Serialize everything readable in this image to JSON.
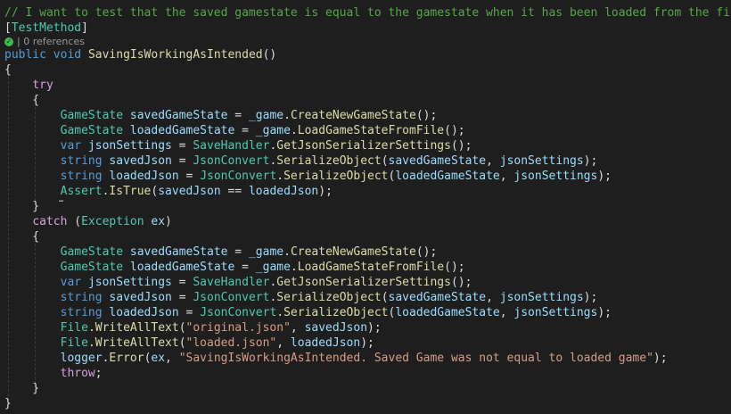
{
  "editor": {
    "codelens_references": "| 0 references",
    "lines": [
      [
        {
          "t": "// I want to test that the saved gamestate is equal to the gamestate when it has been loaded from the file",
          "c": "comment"
        }
      ],
      [
        {
          "t": "[",
          "c": "punct"
        },
        {
          "t": "TestMethod",
          "c": "attr"
        },
        {
          "t": "]",
          "c": "punct"
        }
      ],
      [
        {
          "t": "public",
          "c": "kw"
        },
        {
          "t": " ",
          "c": "punct"
        },
        {
          "t": "void",
          "c": "kw"
        },
        {
          "t": " ",
          "c": "punct"
        },
        {
          "t": "SavingIsWorkingAsIntended",
          "c": "method"
        },
        {
          "t": "()",
          "c": "punct"
        }
      ],
      [
        {
          "t": "{",
          "c": "punct"
        }
      ],
      [
        {
          "t": "    ",
          "c": "punct"
        },
        {
          "t": "try",
          "c": "ctl"
        }
      ],
      [
        {
          "t": "    {",
          "c": "punct"
        }
      ],
      [
        {
          "t": "        ",
          "c": "punct"
        },
        {
          "t": "GameState",
          "c": "type"
        },
        {
          "t": " ",
          "c": "punct"
        },
        {
          "t": "savedGameState",
          "c": "ident"
        },
        {
          "t": " = ",
          "c": "punct"
        },
        {
          "t": "_game",
          "c": "ident"
        },
        {
          "t": ".",
          "c": "punct"
        },
        {
          "t": "CreateNewGameState",
          "c": "method"
        },
        {
          "t": "();",
          "c": "punct"
        }
      ],
      [
        {
          "t": "        ",
          "c": "punct"
        },
        {
          "t": "GameState",
          "c": "type"
        },
        {
          "t": " ",
          "c": "punct"
        },
        {
          "t": "loadedGameState",
          "c": "ident"
        },
        {
          "t": " = ",
          "c": "punct"
        },
        {
          "t": "_game",
          "c": "ident"
        },
        {
          "t": ".",
          "c": "punct"
        },
        {
          "t": "LoadGameStateFromFile",
          "c": "method"
        },
        {
          "t": "();",
          "c": "punct"
        }
      ],
      [
        {
          "t": "        ",
          "c": "punct"
        },
        {
          "t": "var",
          "c": "kw"
        },
        {
          "t": " ",
          "c": "punct"
        },
        {
          "t": "jsonSettings",
          "c": "ident"
        },
        {
          "t": " = ",
          "c": "punct"
        },
        {
          "t": "SaveHandler",
          "c": "type"
        },
        {
          "t": ".",
          "c": "punct"
        },
        {
          "t": "GetJsonSerializerSettings",
          "c": "method"
        },
        {
          "t": "();",
          "c": "punct"
        }
      ],
      [
        {
          "t": "        ",
          "c": "punct"
        },
        {
          "t": "string",
          "c": "kw"
        },
        {
          "t": " ",
          "c": "punct"
        },
        {
          "t": "savedJson",
          "c": "ident"
        },
        {
          "t": " = ",
          "c": "punct"
        },
        {
          "t": "JsonConvert",
          "c": "type"
        },
        {
          "t": ".",
          "c": "punct"
        },
        {
          "t": "SerializeObject",
          "c": "method"
        },
        {
          "t": "(",
          "c": "punct"
        },
        {
          "t": "savedGameState",
          "c": "ident"
        },
        {
          "t": ", ",
          "c": "punct"
        },
        {
          "t": "jsonSettings",
          "c": "ident"
        },
        {
          "t": ");",
          "c": "punct"
        }
      ],
      [
        {
          "t": "        ",
          "c": "punct"
        },
        {
          "t": "string",
          "c": "kw"
        },
        {
          "t": " ",
          "c": "punct"
        },
        {
          "t": "loadedJson",
          "c": "ident"
        },
        {
          "t": " = ",
          "c": "punct"
        },
        {
          "t": "JsonConvert",
          "c": "type"
        },
        {
          "t": ".",
          "c": "punct"
        },
        {
          "t": "SerializeObject",
          "c": "method"
        },
        {
          "t": "(",
          "c": "punct"
        },
        {
          "t": "loadedGameState",
          "c": "ident"
        },
        {
          "t": ", ",
          "c": "punct"
        },
        {
          "t": "jsonSettings",
          "c": "ident"
        },
        {
          "t": ");",
          "c": "punct"
        }
      ],
      [
        {
          "t": "        ",
          "c": "punct"
        },
        {
          "t": "Assert",
          "c": "type"
        },
        {
          "t": ".",
          "c": "punct"
        },
        {
          "t": "IsTrue",
          "c": "method"
        },
        {
          "t": "(",
          "c": "punct"
        },
        {
          "t": "savedJson",
          "c": "ident"
        },
        {
          "t": " == ",
          "c": "punct"
        },
        {
          "t": "loadedJson",
          "c": "ident"
        },
        {
          "t": ");",
          "c": "punct"
        }
      ],
      [
        {
          "t": "    }",
          "c": "punct"
        }
      ],
      [
        {
          "t": "    ",
          "c": "punct"
        },
        {
          "t": "catch",
          "c": "ctl"
        },
        {
          "t": " (",
          "c": "punct"
        },
        {
          "t": "Exception",
          "c": "type"
        },
        {
          "t": " ",
          "c": "punct"
        },
        {
          "t": "ex",
          "c": "ident"
        },
        {
          "t": ")",
          "c": "punct"
        }
      ],
      [
        {
          "t": "    {",
          "c": "punct"
        }
      ],
      [
        {
          "t": "        ",
          "c": "punct"
        },
        {
          "t": "GameState",
          "c": "type"
        },
        {
          "t": " ",
          "c": "punct"
        },
        {
          "t": "savedGameState",
          "c": "ident"
        },
        {
          "t": " = ",
          "c": "punct"
        },
        {
          "t": "_game",
          "c": "ident"
        },
        {
          "t": ".",
          "c": "punct"
        },
        {
          "t": "CreateNewGameState",
          "c": "method"
        },
        {
          "t": "();",
          "c": "punct"
        }
      ],
      [
        {
          "t": "        ",
          "c": "punct"
        },
        {
          "t": "GameState",
          "c": "type"
        },
        {
          "t": " ",
          "c": "punct"
        },
        {
          "t": "loadedGameState",
          "c": "ident"
        },
        {
          "t": " = ",
          "c": "punct"
        },
        {
          "t": "_game",
          "c": "ident"
        },
        {
          "t": ".",
          "c": "punct"
        },
        {
          "t": "LoadGameStateFromFile",
          "c": "method"
        },
        {
          "t": "();",
          "c": "punct"
        }
      ],
      [
        {
          "t": "        ",
          "c": "punct"
        },
        {
          "t": "var",
          "c": "kw"
        },
        {
          "t": " ",
          "c": "punct"
        },
        {
          "t": "jsonSettings",
          "c": "ident"
        },
        {
          "t": " = ",
          "c": "punct"
        },
        {
          "t": "SaveHandler",
          "c": "type"
        },
        {
          "t": ".",
          "c": "punct"
        },
        {
          "t": "GetJsonSerializerSettings",
          "c": "method"
        },
        {
          "t": "();",
          "c": "punct"
        }
      ],
      [
        {
          "t": "        ",
          "c": "punct"
        },
        {
          "t": "string",
          "c": "kw"
        },
        {
          "t": " ",
          "c": "punct"
        },
        {
          "t": "savedJson",
          "c": "ident"
        },
        {
          "t": " = ",
          "c": "punct"
        },
        {
          "t": "JsonConvert",
          "c": "type"
        },
        {
          "t": ".",
          "c": "punct"
        },
        {
          "t": "SerializeObject",
          "c": "method"
        },
        {
          "t": "(",
          "c": "punct"
        },
        {
          "t": "savedGameState",
          "c": "ident"
        },
        {
          "t": ", ",
          "c": "punct"
        },
        {
          "t": "jsonSettings",
          "c": "ident"
        },
        {
          "t": ");",
          "c": "punct"
        }
      ],
      [
        {
          "t": "        ",
          "c": "punct"
        },
        {
          "t": "string",
          "c": "kw"
        },
        {
          "t": " ",
          "c": "punct"
        },
        {
          "t": "loadedJson",
          "c": "ident"
        },
        {
          "t": " = ",
          "c": "punct"
        },
        {
          "t": "JsonConvert",
          "c": "type"
        },
        {
          "t": ".",
          "c": "punct"
        },
        {
          "t": "SerializeObject",
          "c": "method"
        },
        {
          "t": "(",
          "c": "punct"
        },
        {
          "t": "loadedGameState",
          "c": "ident"
        },
        {
          "t": ", ",
          "c": "punct"
        },
        {
          "t": "jsonSettings",
          "c": "ident"
        },
        {
          "t": ");",
          "c": "punct"
        }
      ],
      [
        {
          "t": "        ",
          "c": "punct"
        },
        {
          "t": "File",
          "c": "type"
        },
        {
          "t": ".",
          "c": "punct"
        },
        {
          "t": "WriteAllText",
          "c": "method"
        },
        {
          "t": "(",
          "c": "punct"
        },
        {
          "t": "\"original.json\"",
          "c": "str"
        },
        {
          "t": ", ",
          "c": "punct"
        },
        {
          "t": "savedJson",
          "c": "ident"
        },
        {
          "t": ");",
          "c": "punct"
        }
      ],
      [
        {
          "t": "        ",
          "c": "punct"
        },
        {
          "t": "File",
          "c": "type"
        },
        {
          "t": ".",
          "c": "punct"
        },
        {
          "t": "WriteAllText",
          "c": "method"
        },
        {
          "t": "(",
          "c": "punct"
        },
        {
          "t": "\"loaded.json\"",
          "c": "str"
        },
        {
          "t": ", ",
          "c": "punct"
        },
        {
          "t": "loadedJson",
          "c": "ident"
        },
        {
          "t": ");",
          "c": "punct"
        }
      ],
      [
        {
          "t": "        ",
          "c": "punct"
        },
        {
          "t": "logger",
          "c": "ident"
        },
        {
          "t": ".",
          "c": "punct"
        },
        {
          "t": "Error",
          "c": "method"
        },
        {
          "t": "(",
          "c": "punct"
        },
        {
          "t": "ex",
          "c": "ident"
        },
        {
          "t": ", ",
          "c": "punct"
        },
        {
          "t": "\"SavingIsWorkingAsIntended. Saved Game was not equal to loaded game\"",
          "c": "str"
        },
        {
          "t": ");",
          "c": "punct"
        }
      ],
      [
        {
          "t": "        ",
          "c": "punct"
        },
        {
          "t": "throw",
          "c": "ctl"
        },
        {
          "t": ";",
          "c": "punct"
        }
      ],
      [
        {
          "t": "    }",
          "c": "punct"
        }
      ],
      [
        {
          "t": "}",
          "c": "punct"
        }
      ]
    ]
  }
}
